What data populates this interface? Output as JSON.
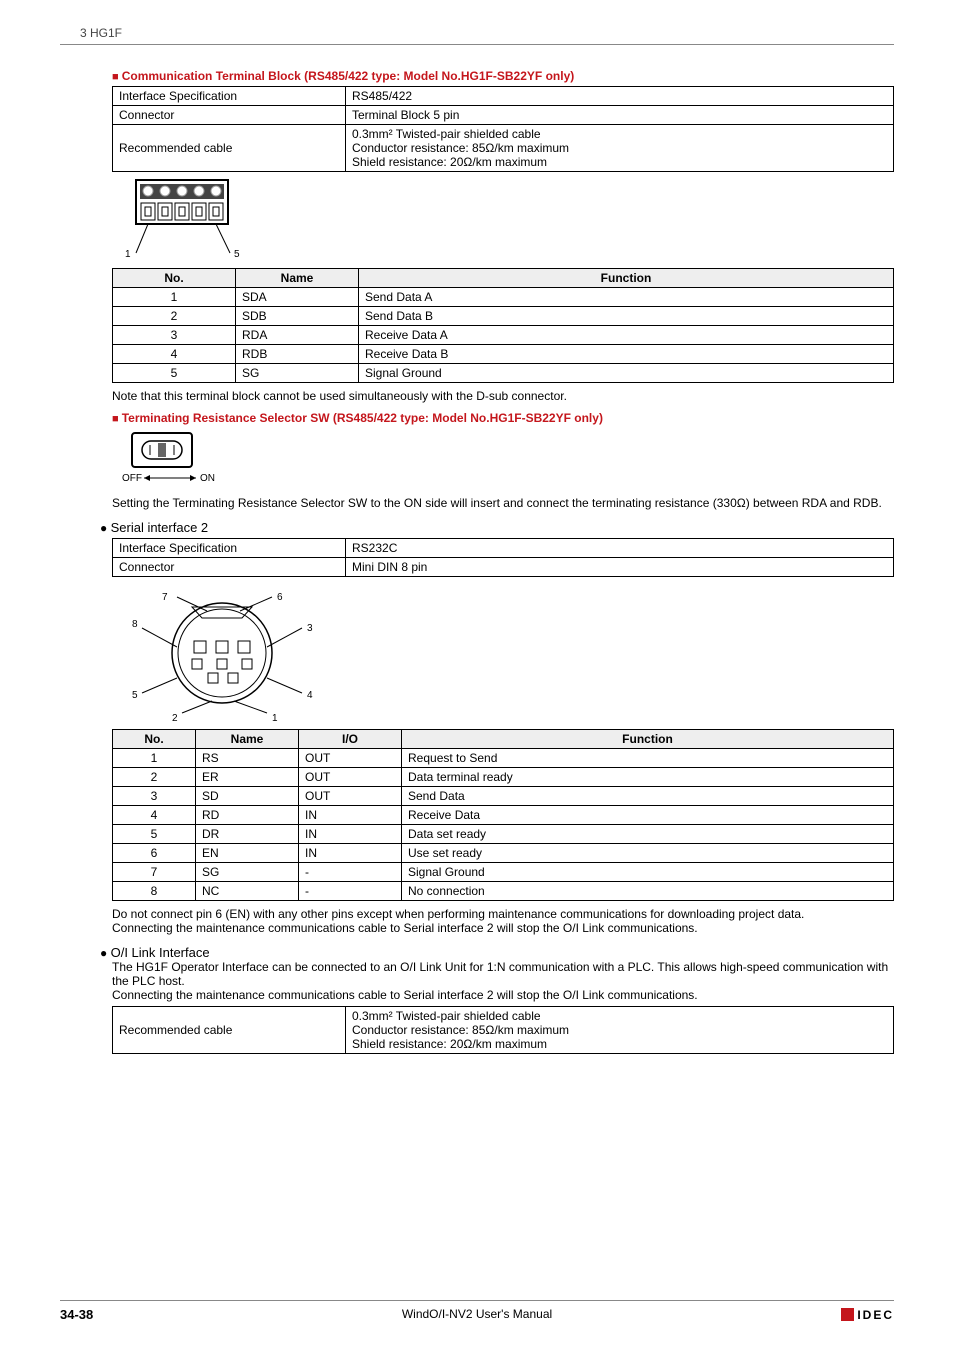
{
  "header": {
    "chapter": "3 HG1F"
  },
  "section1": {
    "title": "Communication Terminal Block (RS485/422 type: Model No.HG1F-SB22YF only)",
    "spec": {
      "r1a": "Interface Specification",
      "r1b": "RS485/422",
      "r2a": "Connector",
      "r2b": "Terminal Block 5 pin",
      "r3a": "Recommended cable",
      "r3b": "0.3mm² Twisted-pair shielded cable\nConductor resistance: 85Ω/km maximum\nShield resistance: 20Ω/km maximum"
    },
    "pinLabelLeft": "1",
    "pinLabelRight": "5",
    "pinHead": {
      "no": "No.",
      "name": "Name",
      "func": "Function"
    },
    "pins": [
      {
        "no": "1",
        "name": "SDA",
        "func": "Send Data A"
      },
      {
        "no": "2",
        "name": "SDB",
        "func": "Send Data B"
      },
      {
        "no": "3",
        "name": "RDA",
        "func": "Receive Data A"
      },
      {
        "no": "4",
        "name": "RDB",
        "func": "Receive Data B"
      },
      {
        "no": "5",
        "name": "SG",
        "func": "Signal Ground"
      }
    ],
    "note": "Note that this terminal block cannot be used simultaneously with the D-sub connector."
  },
  "section2": {
    "title": "Terminating Resistance Selector SW (RS485/422 type: Model No.HG1F-SB22YF only)",
    "off": "OFF",
    "on": "ON",
    "text": "Setting the Terminating Resistance Selector SW to the ON side will insert and connect the terminating resistance (330Ω) between RDA and RDB."
  },
  "section3": {
    "title": "Serial interface 2",
    "spec": {
      "r1a": "Interface Specification",
      "r1b": "RS232C",
      "r2a": "Connector",
      "r2b": "Mini DIN 8 pin"
    },
    "diagLabels": {
      "l1": "1",
      "l2": "2",
      "l3": "3",
      "l4": "4",
      "l5": "5",
      "l6": "6",
      "l7": "7",
      "l8": "8"
    },
    "pinHead": {
      "no": "No.",
      "name": "Name",
      "io": "I/O",
      "func": "Function"
    },
    "pins": [
      {
        "no": "1",
        "name": "RS",
        "io": "OUT",
        "func": "Request to Send"
      },
      {
        "no": "2",
        "name": "ER",
        "io": "OUT",
        "func": "Data terminal ready"
      },
      {
        "no": "3",
        "name": "SD",
        "io": "OUT",
        "func": "Send Data"
      },
      {
        "no": "4",
        "name": "RD",
        "io": "IN",
        "func": "Receive Data"
      },
      {
        "no": "5",
        "name": "DR",
        "io": "IN",
        "func": "Data set ready"
      },
      {
        "no": "6",
        "name": "EN",
        "io": "IN",
        "func": "Use set ready"
      },
      {
        "no": "7",
        "name": "SG",
        "io": "-",
        "func": "Signal Ground"
      },
      {
        "no": "8",
        "name": "NC",
        "io": "-",
        "func": "No connection"
      }
    ],
    "note1": "Do not connect pin 6 (EN) with any other pins except when performing maintenance communications for downloading project data.",
    "note2": "Connecting the maintenance communications cable to Serial interface 2 will stop the O/I Link communications."
  },
  "section4": {
    "title": "O/I Link Interface",
    "text1": "The HG1F Operator Interface can be connected to an O/I Link Unit for 1:N communication with a PLC. This allows high-speed communication with the PLC host.",
    "text2": "Connecting the maintenance communications cable to Serial interface 2 will stop the O/I Link communications.",
    "spec": {
      "r1a": "Recommended cable",
      "r1b": "0.3mm² Twisted-pair shielded cable\nConductor resistance: 85Ω/km maximum\nShield resistance: 20Ω/km maximum"
    }
  },
  "footer": {
    "page": "34-38",
    "manual": "WindO/I-NV2 User's Manual",
    "logo": "IDEC"
  }
}
